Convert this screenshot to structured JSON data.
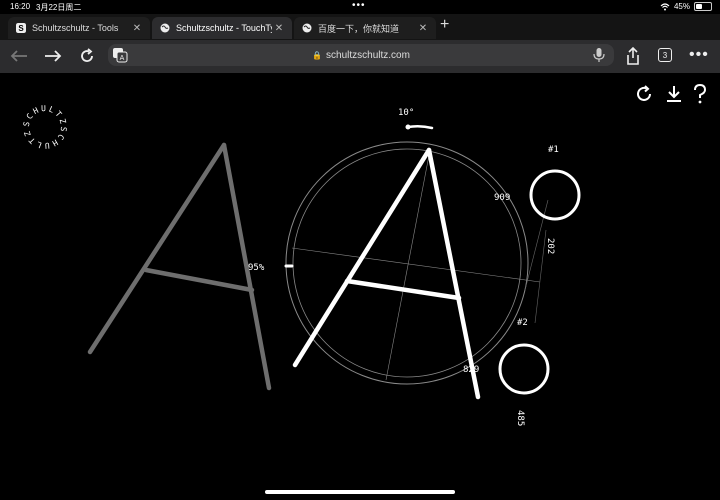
{
  "status": {
    "time": "16:20",
    "date": "3月22日周二",
    "battery_text": "45%",
    "battery_level": 0.45
  },
  "tabs": [
    {
      "label": "Schultzschultz - Tools",
      "favicon": "s-favicon",
      "active": false
    },
    {
      "label": "Schultzschultz - TouchTy",
      "favicon": "globe-icon",
      "active": true
    },
    {
      "label": "百度一下，你就知道",
      "favicon": "globe-icon",
      "active": false
    }
  ],
  "toolbar": {
    "url": "schultzschultz.com",
    "tabs_count": "3"
  },
  "page": {
    "logo_text": "SCHULTZSCHULTZ",
    "rotation_label": "10°",
    "scale_label": "95%",
    "label_909": "909",
    "label_829": "829",
    "label_202": "202",
    "label_485": "485",
    "handle1_label": "#1",
    "handle2_label": "#2"
  },
  "colors": {
    "background": "#000000",
    "ghost_glyph": "#6e6e6e",
    "active_glyph": "#ffffff",
    "guide": "#8a8a8a"
  }
}
